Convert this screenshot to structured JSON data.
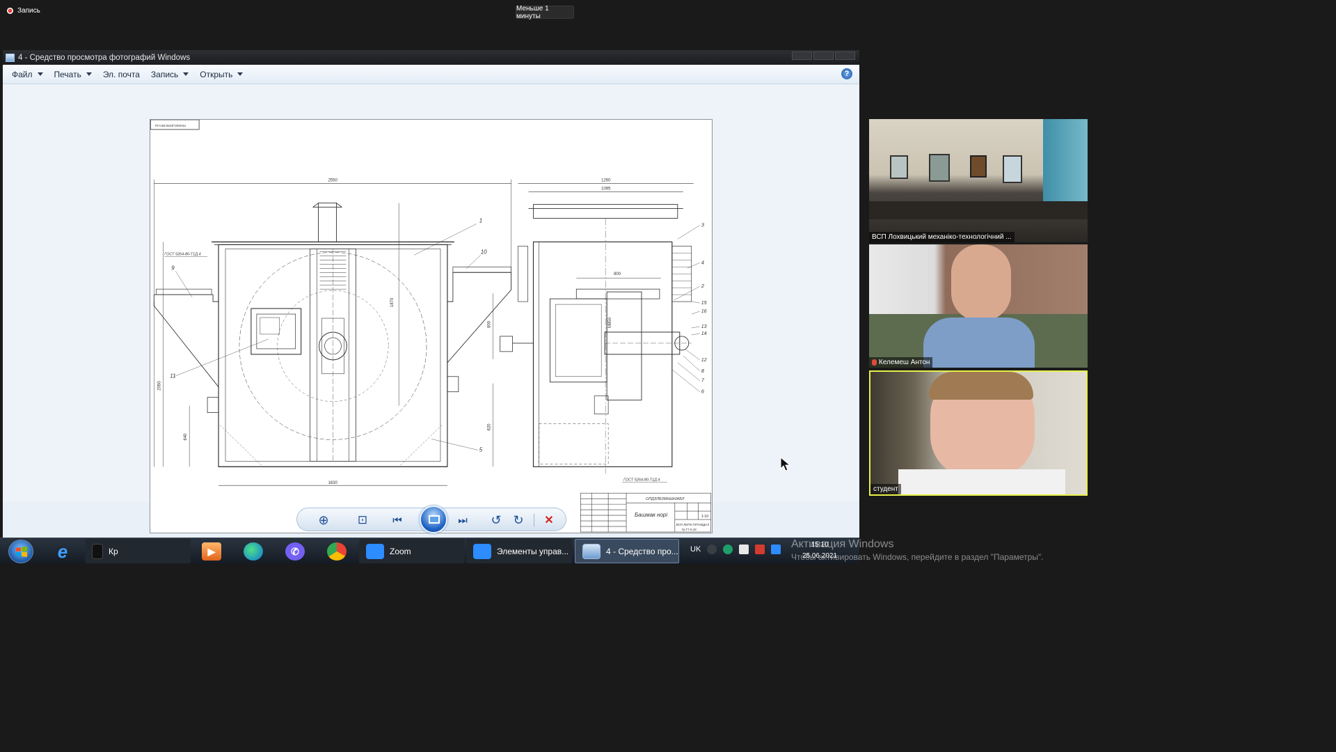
{
  "topbar": {
    "recording_label": "Запись",
    "timer_label": "Меньше 1 минуты"
  },
  "viewer": {
    "title": "4 - Средство просмотра фотографий Windows",
    "menu": [
      {
        "label": "Файл",
        "has_dropdown": true
      },
      {
        "label": "Печать",
        "has_dropdown": true
      },
      {
        "label": "Эл. почта",
        "has_dropdown": false
      },
      {
        "label": "Запись",
        "has_dropdown": true
      },
      {
        "label": "Открыть",
        "has_dropdown": true
      }
    ],
    "help_label": "?",
    "drawing": {
      "corner_stamp": "ЛГАЗБЭМЗПЗМНШ",
      "dimensions": {
        "front_width": "2550",
        "side_width_top": "1260",
        "side_width_second": "1095",
        "front_height_right": "1870",
        "front_height_left": "2050",
        "bottom_width": "1630",
        "lower_left": "640",
        "lower_right": "620",
        "right_mid": "800",
        "side_inner": "800",
        "side_vertical": "M850"
      },
      "gost_left": "ГОСТ 5264-80-Т1Д.4",
      "gost_bottom": "ГОСТ 5264-80-Т1Д.4",
      "callouts_front": [
        "1",
        "10",
        "9",
        "11",
        "5"
      ],
      "callouts_side": [
        "3",
        "4",
        "2",
        "15",
        "16",
        "13",
        "14",
        "12",
        "8",
        "7",
        "6"
      ],
      "title_block": {
        "doc_code": "ОПДЗЛБЗМНШНЖБЛ",
        "name": "Башмак норі",
        "sheet_scale": "1:10",
        "org": "ВСП ЛМТК ПЛТАВДАЛ",
        "group": "Гр.Г7-6.18"
      }
    }
  },
  "controls": {
    "buttons": [
      {
        "name": "zoom",
        "glyph": "⊕"
      },
      {
        "name": "fit",
        "glyph": "⊡"
      },
      {
        "name": "previous",
        "glyph": "⏮"
      },
      {
        "name": "slideshow",
        "glyph": ""
      },
      {
        "name": "next",
        "glyph": "⏭"
      },
      {
        "name": "rotate-left",
        "glyph": "↺"
      },
      {
        "name": "rotate-right",
        "glyph": "↻"
      },
      {
        "name": "delete",
        "glyph": "✕"
      }
    ]
  },
  "taskbar": {
    "buttons": [
      {
        "label": "Кр"
      },
      {
        "label": "Zoom"
      },
      {
        "label": "Элементы управ..."
      },
      {
        "label": "4 - Средство про..."
      }
    ],
    "language": "UK",
    "clock_time": "15:10",
    "clock_date": "25.06.2021"
  },
  "activation": {
    "title": "Активация Windows",
    "subtitle": "Чтобы активировать Windows, перейдите в раздел \"Параметры\"."
  },
  "participants": [
    {
      "name": "ВСП Лохвицький механіко-технологічний ...",
      "muted": false
    },
    {
      "name": "Келемеш Антон",
      "muted": true
    },
    {
      "name": "студент",
      "muted": false,
      "active_speaker": true
    }
  ],
  "colors": {
    "zoom_blue": "#2D8CFF",
    "active_speaker_border": "#E7F04A",
    "recording_red": "#E0433A"
  }
}
